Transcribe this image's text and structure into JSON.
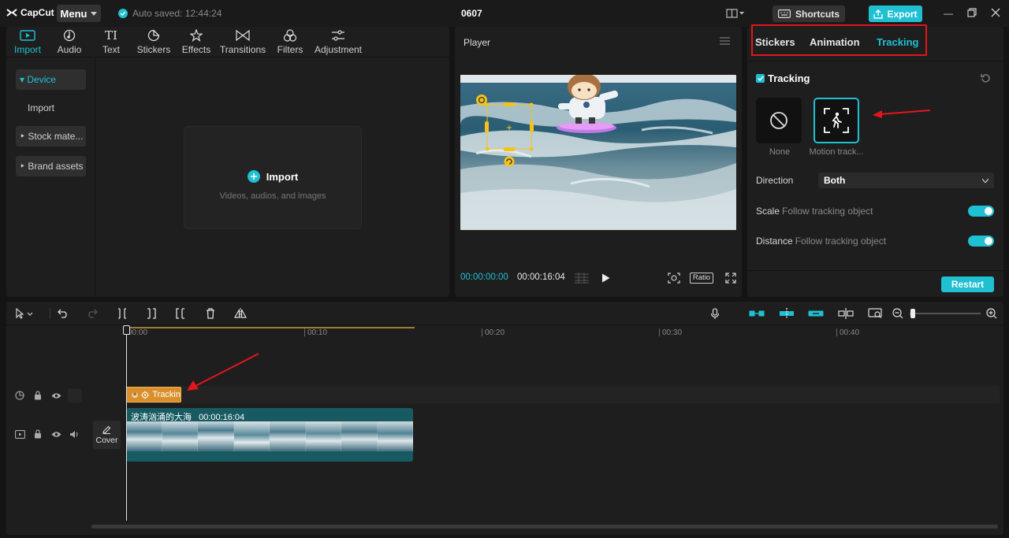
{
  "titlebar": {
    "logo": "CapCut",
    "menu": "Menu",
    "autosave": "Auto saved: 12:44:24",
    "project": "0607",
    "shortcuts": "Shortcuts",
    "export": "Export"
  },
  "media": {
    "tabs": [
      {
        "label": "Import",
        "icon": "import-icon"
      },
      {
        "label": "Audio",
        "icon": "audio-icon"
      },
      {
        "label": "Text",
        "icon": "text-icon"
      },
      {
        "label": "Stickers",
        "icon": "stickers-icon"
      },
      {
        "label": "Effects",
        "icon": "effects-icon"
      },
      {
        "label": "Transitions",
        "icon": "transitions-icon"
      },
      {
        "label": "Filters",
        "icon": "filters-icon"
      },
      {
        "label": "Adjustment",
        "icon": "adjustment-icon"
      }
    ],
    "sidebar": [
      {
        "label": "▾ Device"
      },
      {
        "label": "Import"
      },
      {
        "label": "‣ Stock mate..."
      },
      {
        "label": "‣ Brand assets"
      }
    ],
    "import_title": "Import",
    "import_sub": "Videos, audios, and images"
  },
  "player": {
    "title": "Player",
    "current": "00:00:00:00",
    "total": "00:00:16:04",
    "ratio": "Ratio"
  },
  "tracking_panel": {
    "tabs": [
      "Stickers",
      "Animation",
      "Tracking"
    ],
    "title": "Tracking",
    "options": [
      {
        "label": "None"
      },
      {
        "label": "Motion track..."
      }
    ],
    "direction_label": "Direction",
    "direction_value": "Both",
    "scale_label": "Scale",
    "scale_sub": "Follow tracking object",
    "distance_label": "Distance",
    "distance_sub": "Follow tracking object",
    "restart": "Restart"
  },
  "timeline": {
    "ruler": [
      "00:00",
      "00:10",
      "00:20",
      "00:30",
      "00:40"
    ],
    "tracking_clip": "Trackin",
    "video_clip_name": "波涛汹涌的大海",
    "video_clip_duration": "00:00:16:04",
    "cover": "Cover"
  },
  "colors": {
    "accent": "#1ec0d2",
    "annotation": "#e0161d",
    "tracking_clip": "#d9902a",
    "video_clip": "#175a61"
  }
}
